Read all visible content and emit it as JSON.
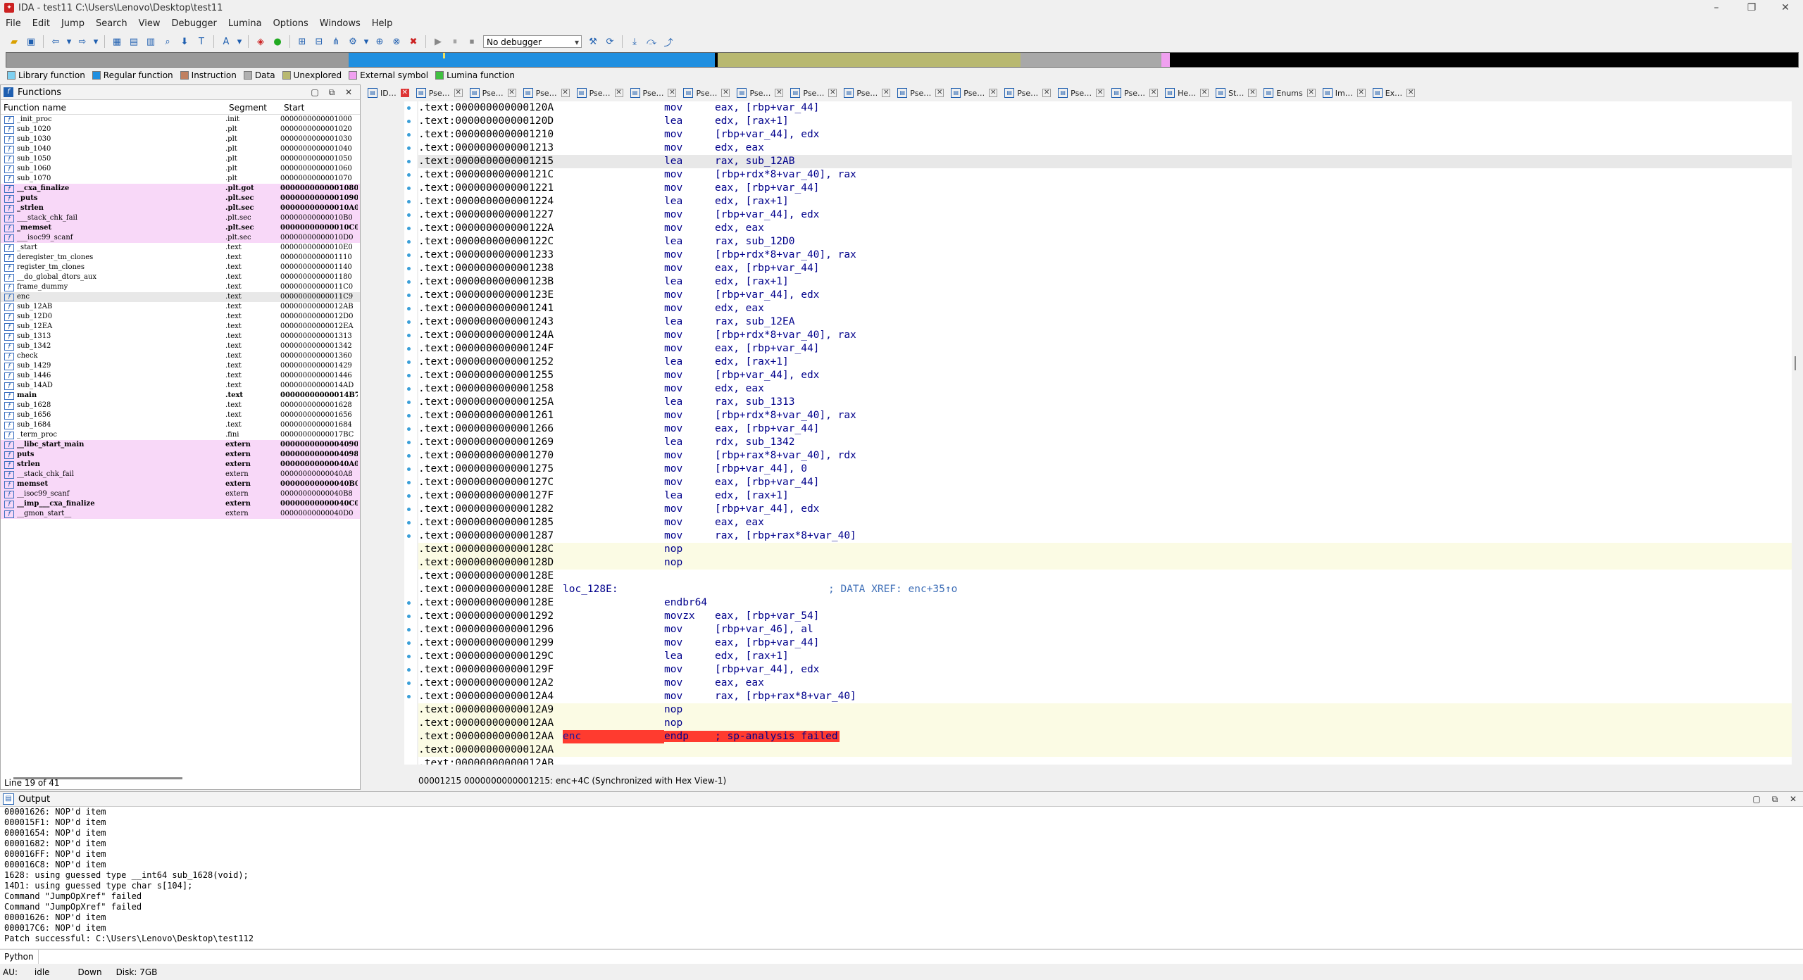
{
  "window": {
    "title": "IDA - test11 C:\\Users\\Lenovo\\Desktop\\test11",
    "minimize": "–",
    "maximize": "❐",
    "close": "✕"
  },
  "menu": [
    "File",
    "Edit",
    "Jump",
    "Search",
    "View",
    "Debugger",
    "Lumina",
    "Options",
    "Windows",
    "Help"
  ],
  "toolbar": {
    "debugger_select": "No debugger"
  },
  "legend": [
    {
      "label": "Library function",
      "color": "#7fd0f0"
    },
    {
      "label": "Regular function",
      "color": "#1f8fe0"
    },
    {
      "label": "Instruction",
      "color": "#c08060"
    },
    {
      "label": "Data",
      "color": "#b0b0b0"
    },
    {
      "label": "Unexplored",
      "color": "#b8b870"
    },
    {
      "label": "External symbol",
      "color": "#f0a0f0"
    },
    {
      "label": "Lumina function",
      "color": "#40c040"
    }
  ],
  "functions": {
    "title": "Functions",
    "columns": [
      "Function name",
      "Segment",
      "Start"
    ],
    "status": "Line 19 of 41",
    "rows": [
      {
        "name": "_init_proc",
        "seg": ".init",
        "start": "0000000000001000",
        "style": ""
      },
      {
        "name": "sub_1020",
        "seg": ".plt",
        "start": "0000000000001020",
        "style": ""
      },
      {
        "name": "sub_1030",
        "seg": ".plt",
        "start": "0000000000001030",
        "style": ""
      },
      {
        "name": "sub_1040",
        "seg": ".plt",
        "start": "0000000000001040",
        "style": ""
      },
      {
        "name": "sub_1050",
        "seg": ".plt",
        "start": "0000000000001050",
        "style": ""
      },
      {
        "name": "sub_1060",
        "seg": ".plt",
        "start": "0000000000001060",
        "style": ""
      },
      {
        "name": "sub_1070",
        "seg": ".plt",
        "start": "0000000000001070",
        "style": ""
      },
      {
        "name": "__cxa_finalize",
        "seg": ".plt.got",
        "start": "0000000000001080",
        "style": "lib bold"
      },
      {
        "name": "_puts",
        "seg": ".plt.sec",
        "start": "0000000000001090",
        "style": "lib bold"
      },
      {
        "name": "_strlen",
        "seg": ".plt.sec",
        "start": "00000000000010A0",
        "style": "lib bold"
      },
      {
        "name": "___stack_chk_fail",
        "seg": ".plt.sec",
        "start": "00000000000010B0",
        "style": "lib"
      },
      {
        "name": "_memset",
        "seg": ".plt.sec",
        "start": "00000000000010C0",
        "style": "lib bold"
      },
      {
        "name": "___isoc99_scanf",
        "seg": ".plt.sec",
        "start": "00000000000010D0",
        "style": "lib"
      },
      {
        "name": "_start",
        "seg": ".text",
        "start": "00000000000010E0",
        "style": ""
      },
      {
        "name": "deregister_tm_clones",
        "seg": ".text",
        "start": "0000000000001110",
        "style": ""
      },
      {
        "name": "register_tm_clones",
        "seg": ".text",
        "start": "0000000000001140",
        "style": ""
      },
      {
        "name": "__do_global_dtors_aux",
        "seg": ".text",
        "start": "0000000000001180",
        "style": ""
      },
      {
        "name": "frame_dummy",
        "seg": ".text",
        "start": "00000000000011C0",
        "style": ""
      },
      {
        "name": "enc",
        "seg": ".text",
        "start": "00000000000011C9",
        "style": "sel"
      },
      {
        "name": "sub_12AB",
        "seg": ".text",
        "start": "00000000000012AB",
        "style": ""
      },
      {
        "name": "sub_12D0",
        "seg": ".text",
        "start": "00000000000012D0",
        "style": ""
      },
      {
        "name": "sub_12EA",
        "seg": ".text",
        "start": "00000000000012EA",
        "style": ""
      },
      {
        "name": "sub_1313",
        "seg": ".text",
        "start": "0000000000001313",
        "style": ""
      },
      {
        "name": "sub_1342",
        "seg": ".text",
        "start": "0000000000001342",
        "style": ""
      },
      {
        "name": "check",
        "seg": ".text",
        "start": "0000000000001360",
        "style": ""
      },
      {
        "name": "sub_1429",
        "seg": ".text",
        "start": "0000000000001429",
        "style": ""
      },
      {
        "name": "sub_1446",
        "seg": ".text",
        "start": "0000000000001446",
        "style": ""
      },
      {
        "name": "sub_14AD",
        "seg": ".text",
        "start": "00000000000014AD",
        "style": ""
      },
      {
        "name": "main",
        "seg": ".text",
        "start": "00000000000014B7",
        "style": "bold"
      },
      {
        "name": "sub_1628",
        "seg": ".text",
        "start": "0000000000001628",
        "style": ""
      },
      {
        "name": "sub_1656",
        "seg": ".text",
        "start": "0000000000001656",
        "style": ""
      },
      {
        "name": "sub_1684",
        "seg": ".text",
        "start": "0000000000001684",
        "style": ""
      },
      {
        "name": "_term_proc",
        "seg": ".fini",
        "start": "00000000000017BC",
        "style": ""
      },
      {
        "name": "__libc_start_main",
        "seg": "extern",
        "start": "0000000000004090",
        "style": "lib bold"
      },
      {
        "name": "puts",
        "seg": "extern",
        "start": "0000000000004098",
        "style": "lib bold"
      },
      {
        "name": "strlen",
        "seg": "extern",
        "start": "00000000000040A0",
        "style": "lib bold"
      },
      {
        "name": "__stack_chk_fail",
        "seg": "extern",
        "start": "00000000000040A8",
        "style": "lib"
      },
      {
        "name": "memset",
        "seg": "extern",
        "start": "00000000000040B0",
        "style": "lib bold"
      },
      {
        "name": "__isoc99_scanf",
        "seg": "extern",
        "start": "00000000000040B8",
        "style": "lib"
      },
      {
        "name": "__imp___cxa_finalize",
        "seg": "extern",
        "start": "00000000000040C0",
        "style": "lib bold"
      },
      {
        "name": "__gmon_start__",
        "seg": "extern",
        "start": "00000000000040D0",
        "style": "lib"
      }
    ]
  },
  "tabs": [
    "ID…",
    "Pse…",
    "Pse…",
    "Pse…",
    "Pse…",
    "Pse…",
    "Pse…",
    "Pse…",
    "Pse…",
    "Pse…",
    "Pse…",
    "Pse…",
    "Pse…",
    "Pse…",
    "Pse…",
    "He…",
    "St…",
    "Enums",
    "Im…",
    "Ex…"
  ],
  "disasm": {
    "lines": [
      {
        "addr": ".text:000000000000120A",
        "label": "",
        "mn": "mov",
        "op": "eax, [rbp+var_44]",
        "cm": "",
        "style": ""
      },
      {
        "addr": ".text:000000000000120D",
        "label": "",
        "mn": "lea",
        "op": "edx, [rax+1]",
        "cm": "",
        "style": ""
      },
      {
        "addr": ".text:0000000000001210",
        "label": "",
        "mn": "mov",
        "op": "[rbp+var_44], edx",
        "cm": "",
        "style": ""
      },
      {
        "addr": ".text:0000000000001213",
        "label": "",
        "mn": "mov",
        "op": "edx, eax",
        "cm": "",
        "style": ""
      },
      {
        "addr": ".text:0000000000001215",
        "label": "",
        "mn": "lea",
        "op": "rax, sub_12AB",
        "cm": "",
        "style": "hl"
      },
      {
        "addr": ".text:000000000000121C",
        "label": "",
        "mn": "mov",
        "op": "[rbp+rdx*8+var_40], rax",
        "cm": "",
        "style": ""
      },
      {
        "addr": ".text:0000000000001221",
        "label": "",
        "mn": "mov",
        "op": "eax, [rbp+var_44]",
        "cm": "",
        "style": ""
      },
      {
        "addr": ".text:0000000000001224",
        "label": "",
        "mn": "lea",
        "op": "edx, [rax+1]",
        "cm": "",
        "style": ""
      },
      {
        "addr": ".text:0000000000001227",
        "label": "",
        "mn": "mov",
        "op": "[rbp+var_44], edx",
        "cm": "",
        "style": ""
      },
      {
        "addr": ".text:000000000000122A",
        "label": "",
        "mn": "mov",
        "op": "edx, eax",
        "cm": "",
        "style": ""
      },
      {
        "addr": ".text:000000000000122C",
        "label": "",
        "mn": "lea",
        "op": "rax, sub_12D0",
        "cm": "",
        "style": ""
      },
      {
        "addr": ".text:0000000000001233",
        "label": "",
        "mn": "mov",
        "op": "[rbp+rdx*8+var_40], rax",
        "cm": "",
        "style": ""
      },
      {
        "addr": ".text:0000000000001238",
        "label": "",
        "mn": "mov",
        "op": "eax, [rbp+var_44]",
        "cm": "",
        "style": ""
      },
      {
        "addr": ".text:000000000000123B",
        "label": "",
        "mn": "lea",
        "op": "edx, [rax+1]",
        "cm": "",
        "style": ""
      },
      {
        "addr": ".text:000000000000123E",
        "label": "",
        "mn": "mov",
        "op": "[rbp+var_44], edx",
        "cm": "",
        "style": ""
      },
      {
        "addr": ".text:0000000000001241",
        "label": "",
        "mn": "mov",
        "op": "edx, eax",
        "cm": "",
        "style": ""
      },
      {
        "addr": ".text:0000000000001243",
        "label": "",
        "mn": "lea",
        "op": "rax, sub_12EA",
        "cm": "",
        "style": ""
      },
      {
        "addr": ".text:000000000000124A",
        "label": "",
        "mn": "mov",
        "op": "[rbp+rdx*8+var_40], rax",
        "cm": "",
        "style": ""
      },
      {
        "addr": ".text:000000000000124F",
        "label": "",
        "mn": "mov",
        "op": "eax, [rbp+var_44]",
        "cm": "",
        "style": ""
      },
      {
        "addr": ".text:0000000000001252",
        "label": "",
        "mn": "lea",
        "op": "edx, [rax+1]",
        "cm": "",
        "style": ""
      },
      {
        "addr": ".text:0000000000001255",
        "label": "",
        "mn": "mov",
        "op": "[rbp+var_44], edx",
        "cm": "",
        "style": ""
      },
      {
        "addr": ".text:0000000000001258",
        "label": "",
        "mn": "mov",
        "op": "edx, eax",
        "cm": "",
        "style": ""
      },
      {
        "addr": ".text:000000000000125A",
        "label": "",
        "mn": "lea",
        "op": "rax, sub_1313",
        "cm": "",
        "style": ""
      },
      {
        "addr": ".text:0000000000001261",
        "label": "",
        "mn": "mov",
        "op": "[rbp+rdx*8+var_40], rax",
        "cm": "",
        "style": ""
      },
      {
        "addr": ".text:0000000000001266",
        "label": "",
        "mn": "mov",
        "op": "eax, [rbp+var_44]",
        "cm": "",
        "style": ""
      },
      {
        "addr": ".text:0000000000001269",
        "label": "",
        "mn": "lea",
        "op": "rdx, sub_1342",
        "cm": "",
        "style": ""
      },
      {
        "addr": ".text:0000000000001270",
        "label": "",
        "mn": "mov",
        "op": "[rbp+rax*8+var_40], rdx",
        "cm": "",
        "style": ""
      },
      {
        "addr": ".text:0000000000001275",
        "label": "",
        "mn": "mov",
        "op": "[rbp+var_44], 0",
        "cm": "",
        "style": ""
      },
      {
        "addr": ".text:000000000000127C",
        "label": "",
        "mn": "mov",
        "op": "eax, [rbp+var_44]",
        "cm": "",
        "style": ""
      },
      {
        "addr": ".text:000000000000127F",
        "label": "",
        "mn": "lea",
        "op": "edx, [rax+1]",
        "cm": "",
        "style": ""
      },
      {
        "addr": ".text:0000000000001282",
        "label": "",
        "mn": "mov",
        "op": "[rbp+var_44], edx",
        "cm": "",
        "style": ""
      },
      {
        "addr": ".text:0000000000001285",
        "label": "",
        "mn": "mov",
        "op": "eax, eax",
        "cm": "",
        "style": ""
      },
      {
        "addr": ".text:0000000000001287",
        "label": "",
        "mn": "mov",
        "op": "rax, [rbp+rax*8+var_40]",
        "cm": "",
        "style": ""
      },
      {
        "addr": ".text:000000000000128C",
        "label": "",
        "mn": "nop",
        "op": "",
        "cm": "",
        "style": "nop"
      },
      {
        "addr": ".text:000000000000128D",
        "label": "",
        "mn": "nop",
        "op": "",
        "cm": "",
        "style": "nop"
      },
      {
        "addr": ".text:000000000000128E",
        "label": "",
        "mn": "",
        "op": "",
        "cm": "",
        "style": ""
      },
      {
        "addr": ".text:000000000000128E",
        "label": "loc_128E:",
        "mn": "",
        "op": "",
        "cm": "; DATA XREF: enc+35↑o",
        "style": ""
      },
      {
        "addr": ".text:000000000000128E",
        "label": "",
        "mn": "endbr64",
        "op": "",
        "cm": "",
        "style": ""
      },
      {
        "addr": ".text:0000000000001292",
        "label": "",
        "mn": "movzx",
        "op": "eax, [rbp+var_54]",
        "cm": "",
        "style": ""
      },
      {
        "addr": ".text:0000000000001296",
        "label": "",
        "mn": "mov",
        "op": "[rbp+var_46], al",
        "cm": "",
        "style": ""
      },
      {
        "addr": ".text:0000000000001299",
        "label": "",
        "mn": "mov",
        "op": "eax, [rbp+var_44]",
        "cm": "",
        "style": ""
      },
      {
        "addr": ".text:000000000000129C",
        "label": "",
        "mn": "lea",
        "op": "edx, [rax+1]",
        "cm": "",
        "style": ""
      },
      {
        "addr": ".text:000000000000129F",
        "label": "",
        "mn": "mov",
        "op": "[rbp+var_44], edx",
        "cm": "",
        "style": ""
      },
      {
        "addr": ".text:00000000000012A2",
        "label": "",
        "mn": "mov",
        "op": "eax, eax",
        "cm": "",
        "style": ""
      },
      {
        "addr": ".text:00000000000012A4",
        "label": "",
        "mn": "mov",
        "op": "rax, [rbp+rax*8+var_40]",
        "cm": "",
        "style": ""
      },
      {
        "addr": ".text:00000000000012A9",
        "label": "",
        "mn": "nop",
        "op": "",
        "cm": "",
        "style": "nop"
      },
      {
        "addr": ".text:00000000000012AA",
        "label": "",
        "mn": "nop",
        "op": "",
        "cm": "",
        "style": "nop"
      },
      {
        "addr": ".text:00000000000012AA",
        "label": "enc",
        "mn": "endp",
        "op": "; sp-analysis failed",
        "cm": "",
        "style": "nop err"
      },
      {
        "addr": ".text:00000000000012AA",
        "label": "",
        "mn": "",
        "op": "",
        "cm": "",
        "style": "nop"
      },
      {
        "addr": ".text:00000000000012AB",
        "label": "",
        "mn": "",
        "op": "",
        "cm": "",
        "style": ""
      }
    ],
    "status": "00001215 0000000000001215: enc+4C (Synchronized with Hex View-1)"
  },
  "output": {
    "title": "Output",
    "lines": [
      "00001626: NOP'd item",
      "000015F1: NOP'd item",
      "00001654: NOP'd item",
      "00001682: NOP'd item",
      "000016FF: NOP'd item",
      "000016C8: NOP'd item",
      "1628: using guessed type __int64 sub_1628(void);",
      "14D1: using guessed type char s[104];",
      "Command \"JumpOpXref\" failed",
      "Command \"JumpOpXref\" failed",
      "00001626: NOP'd item",
      "000017C6: NOP'd item",
      "Patch successful: C:\\Users\\Lenovo\\Desktop\\test112"
    ]
  },
  "python": {
    "label": "Python",
    "value": ""
  },
  "statusbar": {
    "au": "AU:",
    "state": "idle",
    "dir": "Down",
    "disk": "Disk: 7GB"
  }
}
